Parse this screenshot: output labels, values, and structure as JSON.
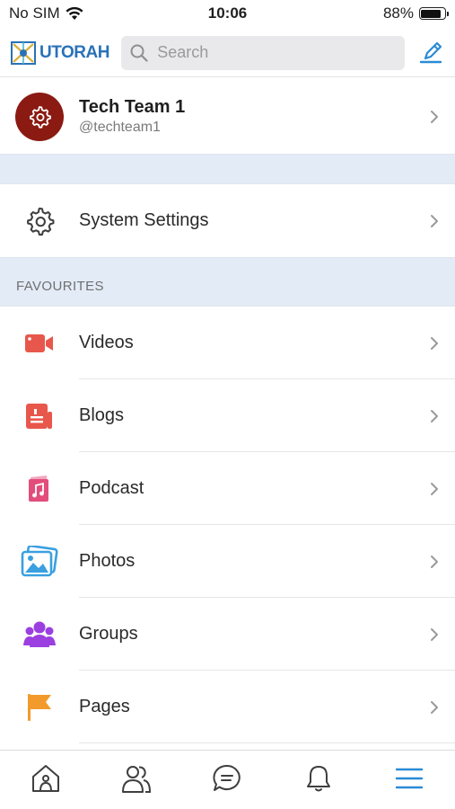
{
  "status_bar": {
    "carrier": "No SIM",
    "time": "10:06",
    "battery": "88%",
    "battery_level": 0.88
  },
  "header": {
    "logo_text": "UTORAH",
    "search_placeholder": "Search",
    "compose_icon": "compose-icon"
  },
  "profile": {
    "name": "Tech Team 1",
    "handle": "@techteam1",
    "avatar_icon": "gear-icon",
    "avatar_color": "#8b1a12"
  },
  "settings": {
    "label": "System Settings",
    "icon": "gear-icon"
  },
  "favourites": {
    "section_title": "FAVOURITES",
    "items": [
      {
        "label": "Videos",
        "icon": "video-icon",
        "color": "#e8574b"
      },
      {
        "label": "Blogs",
        "icon": "blog-icon",
        "color": "#e8574b"
      },
      {
        "label": "Podcast",
        "icon": "podcast-icon",
        "color": "#e24d7c"
      },
      {
        "label": "Photos",
        "icon": "photos-icon",
        "color": "#3aa0e0"
      },
      {
        "label": "Groups",
        "icon": "groups-icon",
        "color": "#9b3fe0"
      },
      {
        "label": "Pages",
        "icon": "flag-icon",
        "color": "#f39a2c"
      }
    ]
  },
  "tabbar": {
    "tabs": [
      {
        "name": "home",
        "icon": "home-icon"
      },
      {
        "name": "friends",
        "icon": "friends-icon"
      },
      {
        "name": "messages",
        "icon": "chat-icon"
      },
      {
        "name": "notifications",
        "icon": "bell-icon"
      },
      {
        "name": "menu",
        "icon": "menu-icon",
        "active": true
      }
    ],
    "accent": "#2a8bd6",
    "inactive": "#3f3f3f"
  },
  "colors": {
    "band": "#e3ebf7",
    "accent": "#2a8bd6"
  }
}
